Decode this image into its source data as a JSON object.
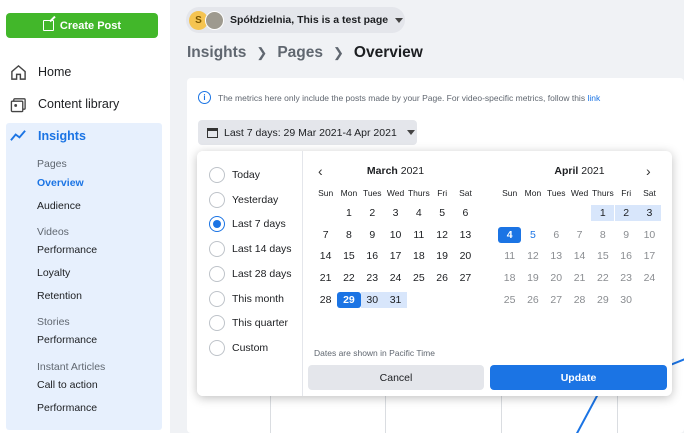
{
  "sidebar": {
    "create_post": "Create Post",
    "home": "Home",
    "content_library": "Content library",
    "insights": "Insights",
    "sections": [
      {
        "title": "Pages",
        "items": [
          "Overview",
          "Audience"
        ]
      },
      {
        "title": "Videos",
        "items": [
          "Performance",
          "Loyalty",
          "Retention"
        ]
      },
      {
        "title": "Stories",
        "items": [
          "Performance"
        ]
      },
      {
        "title": "Instant Articles",
        "items": [
          "Call to action",
          "Performance"
        ]
      }
    ],
    "active_item": "Overview"
  },
  "page_selector": {
    "avatar_letter": "S",
    "label": "Spółdzielnia, This is a test page"
  },
  "breadcrumb": [
    "Insights",
    "Pages",
    "Overview"
  ],
  "info_text": "The metrics here only include the posts made by your Page. For video-specific metrics, follow this",
  "info_link": "link",
  "date_range_button": "Last 7 days: 29 Mar 2021-4 Apr 2021",
  "date_options": [
    {
      "label": "Today",
      "selected": false
    },
    {
      "label": "Yesterday",
      "selected": false
    },
    {
      "label": "Last 7 days",
      "selected": true
    },
    {
      "label": "Last 14 days",
      "selected": false
    },
    {
      "label": "Last 28 days",
      "selected": false
    },
    {
      "label": "This month",
      "selected": false
    },
    {
      "label": "This quarter",
      "selected": false
    },
    {
      "label": "Custom",
      "selected": false
    }
  ],
  "weekdays": [
    "Sun",
    "Mon",
    "Tues",
    "Wed",
    "Thurs",
    "Fri",
    "Sat"
  ],
  "march": {
    "month": "March",
    "year": "2021",
    "first_weekday": 1,
    "days": 31
  },
  "april": {
    "month": "April",
    "year": "2021",
    "first_weekday": 4,
    "days": 30
  },
  "selection": {
    "start": "29 Mar 2021",
    "end": "4 Apr 2021",
    "today": "5 Apr 2021"
  },
  "tz_note": "Dates are shown in Pacific Time",
  "cancel_label": "Cancel",
  "update_label": "Update",
  "colors": {
    "accent": "#1b74e4",
    "create": "#42b72a",
    "range": "#d8e6fb"
  }
}
